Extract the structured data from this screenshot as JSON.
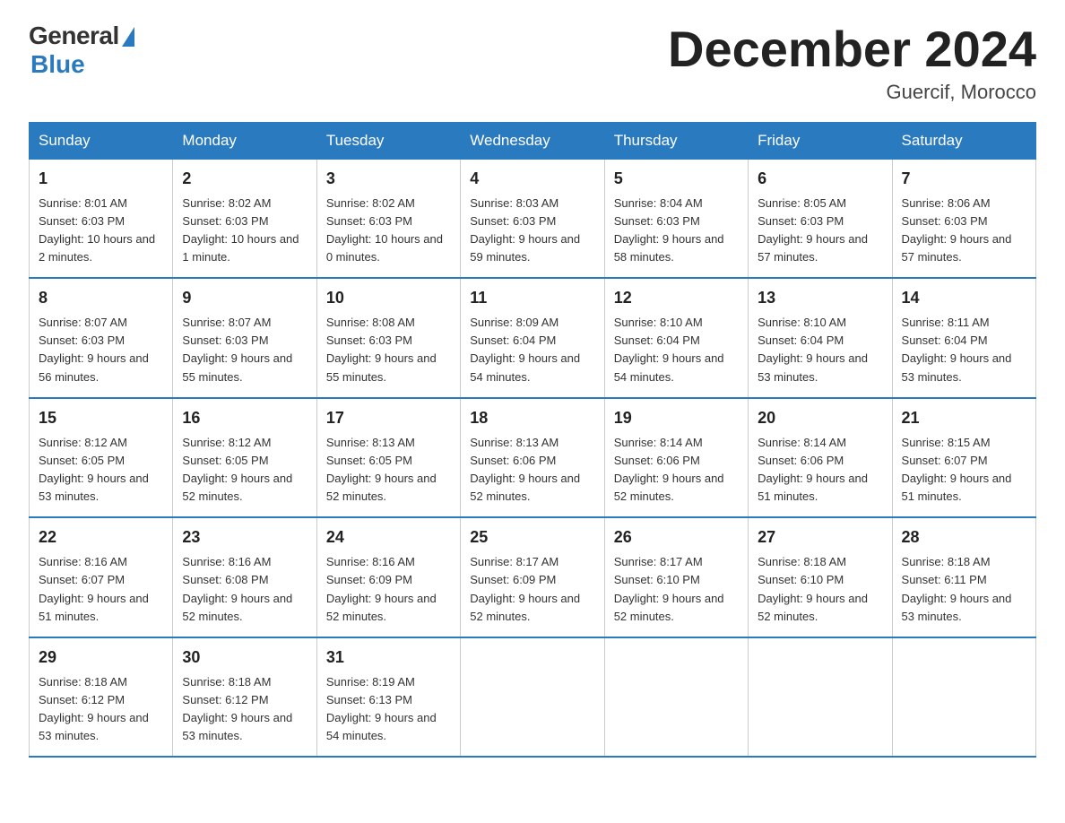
{
  "logo": {
    "general": "General",
    "blue": "Blue",
    "tagline": "Blue"
  },
  "header": {
    "month": "December 2024",
    "location": "Guercif, Morocco"
  },
  "weekdays": [
    "Sunday",
    "Monday",
    "Tuesday",
    "Wednesday",
    "Thursday",
    "Friday",
    "Saturday"
  ],
  "weeks": [
    [
      {
        "day": "1",
        "sunrise": "8:01 AM",
        "sunset": "6:03 PM",
        "daylight": "10 hours and 2 minutes."
      },
      {
        "day": "2",
        "sunrise": "8:02 AM",
        "sunset": "6:03 PM",
        "daylight": "10 hours and 1 minute."
      },
      {
        "day": "3",
        "sunrise": "8:02 AM",
        "sunset": "6:03 PM",
        "daylight": "10 hours and 0 minutes."
      },
      {
        "day": "4",
        "sunrise": "8:03 AM",
        "sunset": "6:03 PM",
        "daylight": "9 hours and 59 minutes."
      },
      {
        "day": "5",
        "sunrise": "8:04 AM",
        "sunset": "6:03 PM",
        "daylight": "9 hours and 58 minutes."
      },
      {
        "day": "6",
        "sunrise": "8:05 AM",
        "sunset": "6:03 PM",
        "daylight": "9 hours and 57 minutes."
      },
      {
        "day": "7",
        "sunrise": "8:06 AM",
        "sunset": "6:03 PM",
        "daylight": "9 hours and 57 minutes."
      }
    ],
    [
      {
        "day": "8",
        "sunrise": "8:07 AM",
        "sunset": "6:03 PM",
        "daylight": "9 hours and 56 minutes."
      },
      {
        "day": "9",
        "sunrise": "8:07 AM",
        "sunset": "6:03 PM",
        "daylight": "9 hours and 55 minutes."
      },
      {
        "day": "10",
        "sunrise": "8:08 AM",
        "sunset": "6:03 PM",
        "daylight": "9 hours and 55 minutes."
      },
      {
        "day": "11",
        "sunrise": "8:09 AM",
        "sunset": "6:04 PM",
        "daylight": "9 hours and 54 minutes."
      },
      {
        "day": "12",
        "sunrise": "8:10 AM",
        "sunset": "6:04 PM",
        "daylight": "9 hours and 54 minutes."
      },
      {
        "day": "13",
        "sunrise": "8:10 AM",
        "sunset": "6:04 PM",
        "daylight": "9 hours and 53 minutes."
      },
      {
        "day": "14",
        "sunrise": "8:11 AM",
        "sunset": "6:04 PM",
        "daylight": "9 hours and 53 minutes."
      }
    ],
    [
      {
        "day": "15",
        "sunrise": "8:12 AM",
        "sunset": "6:05 PM",
        "daylight": "9 hours and 53 minutes."
      },
      {
        "day": "16",
        "sunrise": "8:12 AM",
        "sunset": "6:05 PM",
        "daylight": "9 hours and 52 minutes."
      },
      {
        "day": "17",
        "sunrise": "8:13 AM",
        "sunset": "6:05 PM",
        "daylight": "9 hours and 52 minutes."
      },
      {
        "day": "18",
        "sunrise": "8:13 AM",
        "sunset": "6:06 PM",
        "daylight": "9 hours and 52 minutes."
      },
      {
        "day": "19",
        "sunrise": "8:14 AM",
        "sunset": "6:06 PM",
        "daylight": "9 hours and 52 minutes."
      },
      {
        "day": "20",
        "sunrise": "8:14 AM",
        "sunset": "6:06 PM",
        "daylight": "9 hours and 51 minutes."
      },
      {
        "day": "21",
        "sunrise": "8:15 AM",
        "sunset": "6:07 PM",
        "daylight": "9 hours and 51 minutes."
      }
    ],
    [
      {
        "day": "22",
        "sunrise": "8:16 AM",
        "sunset": "6:07 PM",
        "daylight": "9 hours and 51 minutes."
      },
      {
        "day": "23",
        "sunrise": "8:16 AM",
        "sunset": "6:08 PM",
        "daylight": "9 hours and 52 minutes."
      },
      {
        "day": "24",
        "sunrise": "8:16 AM",
        "sunset": "6:09 PM",
        "daylight": "9 hours and 52 minutes."
      },
      {
        "day": "25",
        "sunrise": "8:17 AM",
        "sunset": "6:09 PM",
        "daylight": "9 hours and 52 minutes."
      },
      {
        "day": "26",
        "sunrise": "8:17 AM",
        "sunset": "6:10 PM",
        "daylight": "9 hours and 52 minutes."
      },
      {
        "day": "27",
        "sunrise": "8:18 AM",
        "sunset": "6:10 PM",
        "daylight": "9 hours and 52 minutes."
      },
      {
        "day": "28",
        "sunrise": "8:18 AM",
        "sunset": "6:11 PM",
        "daylight": "9 hours and 53 minutes."
      }
    ],
    [
      {
        "day": "29",
        "sunrise": "8:18 AM",
        "sunset": "6:12 PM",
        "daylight": "9 hours and 53 minutes."
      },
      {
        "day": "30",
        "sunrise": "8:18 AM",
        "sunset": "6:12 PM",
        "daylight": "9 hours and 53 minutes."
      },
      {
        "day": "31",
        "sunrise": "8:19 AM",
        "sunset": "6:13 PM",
        "daylight": "9 hours and 54 minutes."
      },
      null,
      null,
      null,
      null
    ]
  ]
}
